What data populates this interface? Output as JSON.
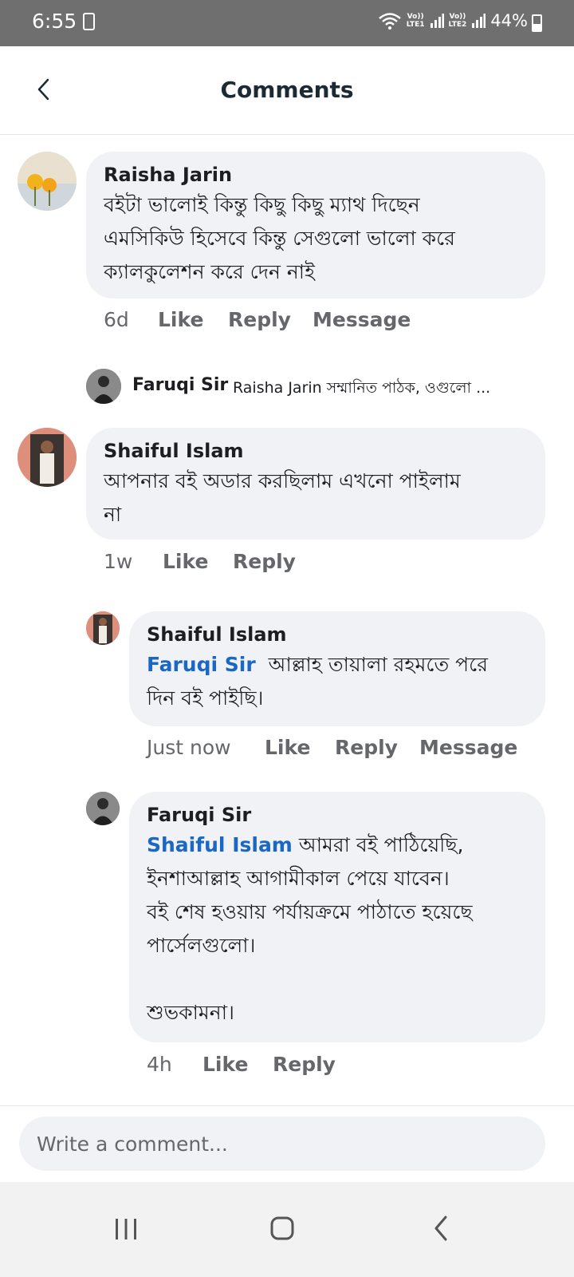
{
  "status_bar": {
    "time": "6:55",
    "battery": "44%",
    "sim1_label": "Vo))\nLTE1",
    "sim2_label": "Vo))\nLTE2"
  },
  "header": {
    "title": "Comments"
  },
  "comments": [
    {
      "author": "Raisha Jarin",
      "text_lines": [
        "বইটা ভালোই কিন্তু কিছু কিছু ম্যাথ দিছেন",
        "এমসিকিউ হিসেবে  কিন্তু সেগুলো ভালো করে",
        "ক্যালকুলেশন করে দেন নাই"
      ],
      "time": "6d",
      "like": "Like",
      "reply": "Reply",
      "message": "Message"
    },
    {
      "author": "Shaiful Islam",
      "text_lines": [
        "আপনার বই অডার করছিলাম এখনো পাইলাম",
        "না"
      ],
      "time": "1w",
      "like": "Like",
      "reply": "Reply"
    }
  ],
  "reply_summary": {
    "author": "Faruqi Sir",
    "text": "Raisha Jarin সম্মানিত পাঠক, ওগুলো ..."
  },
  "replies": [
    {
      "author": "Shaiful Islam",
      "mention": "Faruqi Sir",
      "text_first": "  আল্লাহ তায়ালা রহমতে পরে",
      "text_lines": [
        "দিন বই পাইছি।"
      ],
      "time": "Just now",
      "like": "Like",
      "reply": "Reply",
      "message": "Message"
    },
    {
      "author": "Faruqi Sir",
      "mention": "Shaiful Islam",
      "text_first": " আমরা বই পাঠিয়েছি,",
      "text_lines": [
        "ইনশাআল্লাহ আগামীকাল পেয়ে যাবেন।",
        "বই শেষ হওয়ায় পর্যায়ক্রমে পাঠাতে হয়েছে",
        "পার্সেলগুলো।",
        "",
        "শুভকামনা।"
      ],
      "time": "4h",
      "like": "Like",
      "reply": "Reply"
    }
  ],
  "composer": {
    "placeholder": "Write a comment..."
  },
  "icons": {
    "back": "chevron-left-icon",
    "nav_recents": "recents-icon",
    "nav_home": "home-icon",
    "nav_back": "back-icon"
  },
  "colors": {
    "mention": "#1a67c4",
    "bubble": "#f0f2f5",
    "status_bar": "#6f6f6f"
  }
}
